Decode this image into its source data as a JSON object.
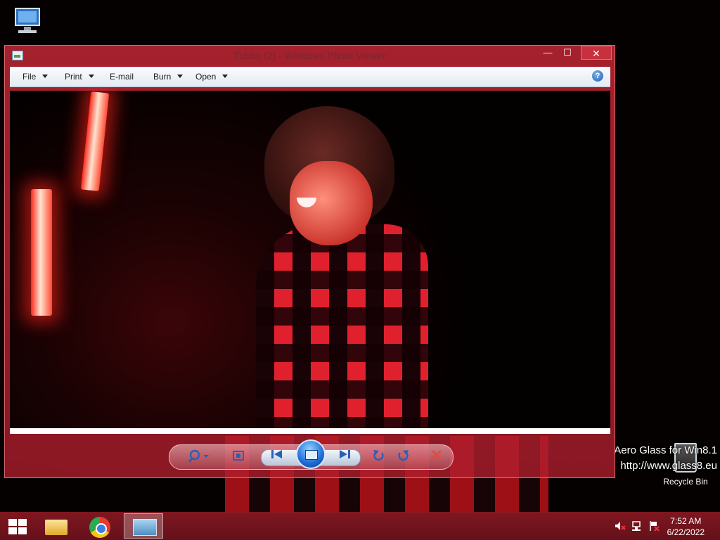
{
  "window": {
    "title": "Tubbo (2) - Windows Photo Viewer",
    "min_label": "—",
    "max_label": "☐",
    "close_label": "✕"
  },
  "menu": {
    "items": [
      {
        "label": "File"
      },
      {
        "label": "Print"
      },
      {
        "label": "E-mail"
      },
      {
        "label": "Burn"
      },
      {
        "label": "Open"
      }
    ],
    "help_label": "?"
  },
  "controls": {
    "zoom_icon": "magnifier-icon",
    "fit_icon": "actual-size-icon",
    "prev_icon": "previous-icon",
    "slideshow_icon": "slideshow-icon",
    "next_icon": "next-icon",
    "rotate_ccw_icon": "rotate-counterclockwise-icon",
    "rotate_cw_icon": "rotate-clockwise-icon",
    "delete_icon": "delete-icon"
  },
  "desktop": {
    "recycle_bin_label": "Recycle Bin",
    "watermark_line1": "Aero Glass for Win8.1",
    "watermark_line2": "http://www.glass8.eu"
  },
  "taskbar": {
    "time": "7:52 AM",
    "date": "6/22/2022",
    "apps": [
      "file-explorer",
      "google-chrome",
      "windows-photo-viewer"
    ],
    "accent_color": "#8c1923"
  }
}
